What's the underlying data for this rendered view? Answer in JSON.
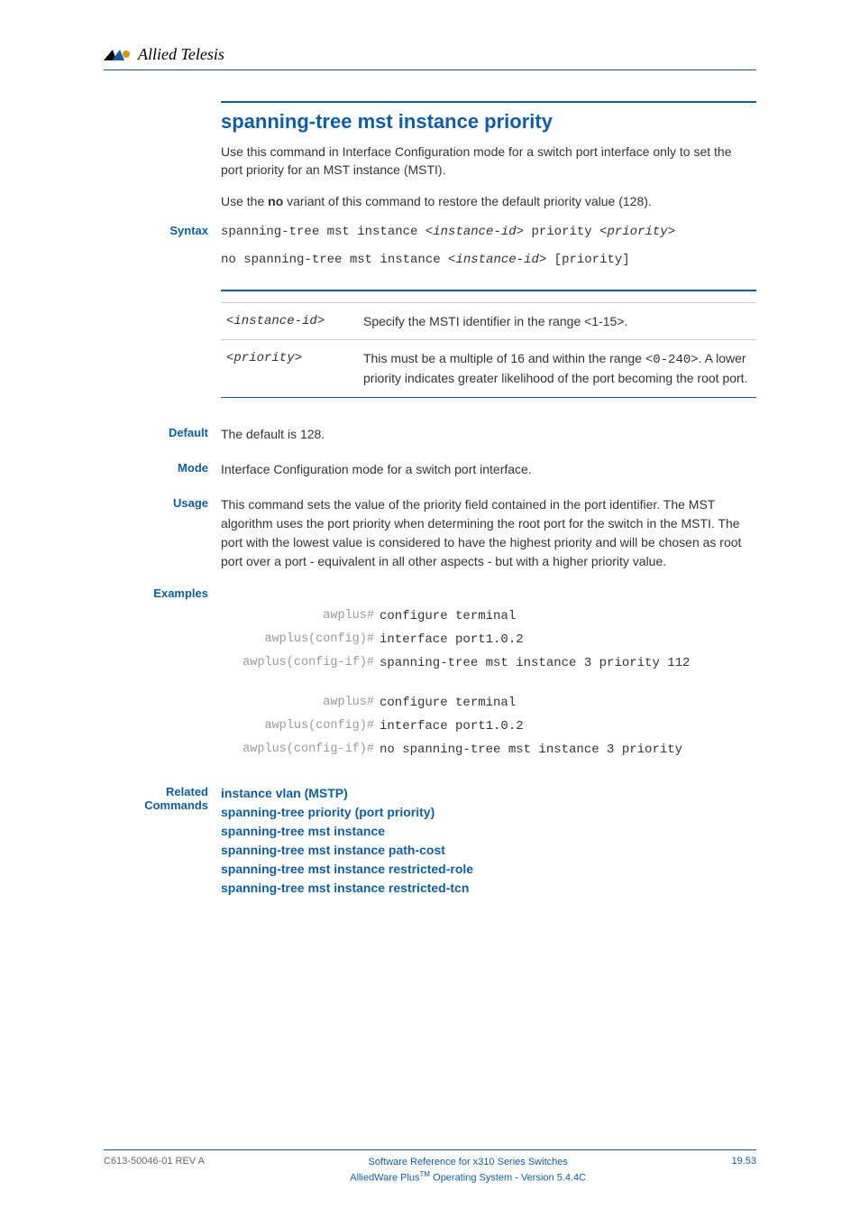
{
  "header": {
    "brand": "Allied Telesis"
  },
  "title": "spanning-tree mst instance priority",
  "intro": [
    "Use this command in Interface Configuration mode for a switch port interface only to set the port priority for an MST instance (MSTI).",
    "Use the no variant of this command to restore the default priority value (128)."
  ],
  "labels": {
    "syntax": "Syntax",
    "default": "Default",
    "mode": "Mode",
    "usage": "Usage",
    "examples": "Examples",
    "related": "Related Commands"
  },
  "syntax": {
    "line1_pre": "spanning-tree mst instance ",
    "line1_arg1": "<instance-id>",
    "line1_mid": " priority ",
    "line1_arg2": "<priority>",
    "line2_pre": "no spanning-tree mst instance ",
    "line2_arg": "<instance-id>",
    "line2_post": " [priority]"
  },
  "params": [
    {
      "name": "<instance-id>",
      "desc": "Specify the MSTI identifier in the range <1-15>."
    },
    {
      "name": "<priority>",
      "desc_pre": "This must be a multiple of 16 and within the range ",
      "desc_code": "<0-240>",
      "desc_post": ". A lower priority indicates greater likelihood of the port becoming the root port."
    }
  ],
  "default": "The default is 128.",
  "mode": "Interface Configuration mode for a switch port interface.",
  "usage": "This command sets the value of the priority field contained in the port identifier. The MST algorithm uses the port priority when determining the root port for the switch in the MSTI. The port with the lowest value is considered to have the highest priority and will be chosen as root port over a port - equivalent in all other aspects - but with a higher priority value.",
  "examples": [
    [
      {
        "prompt": "awplus#",
        "cmd": "configure terminal"
      },
      {
        "prompt": "awplus(config)#",
        "cmd": "interface port1.0.2"
      },
      {
        "prompt": "awplus(config-if)#",
        "cmd": "spanning-tree mst instance 3 priority 112"
      }
    ],
    [
      {
        "prompt": "awplus#",
        "cmd": "configure terminal"
      },
      {
        "prompt": "awplus(config)#",
        "cmd": "interface port1.0.2"
      },
      {
        "prompt": "awplus(config-if)#",
        "cmd": "no spanning-tree mst instance 3 priority"
      }
    ]
  ],
  "related": [
    "instance vlan (MSTP)",
    "spanning-tree priority (port priority)",
    "spanning-tree mst instance",
    "spanning-tree mst instance path-cost",
    "spanning-tree mst instance restricted-role",
    "spanning-tree mst instance restricted-tcn"
  ],
  "footer": {
    "left": "C613-50046-01 REV A",
    "center1": "Software Reference for x310 Series Switches",
    "center2_pre": "AlliedWare Plus",
    "center2_post": " Operating System - Version 5.4.4C",
    "right": "19.53"
  }
}
